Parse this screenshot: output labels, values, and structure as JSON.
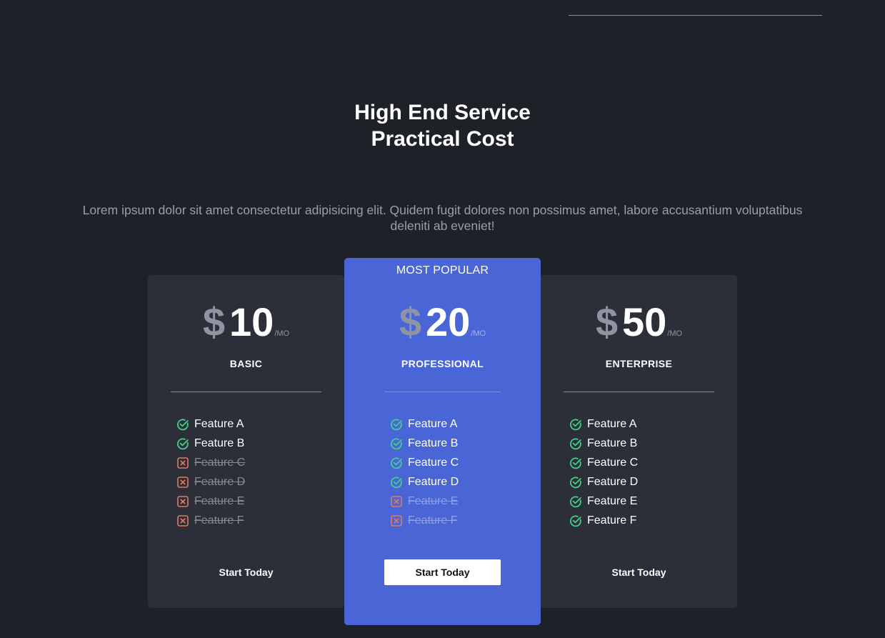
{
  "hero": {
    "title_line1": "High End Service",
    "title_line2": "Practical Cost",
    "description": "Lorem ipsum dolor sit amet consectetur adipisicing elit. Quidem fugit dolores non possimus amet, labore accusantium voluptatibus deleniti ab eveniet!"
  },
  "colors": {
    "background": "#1f2129",
    "card": "#2c2f38",
    "accent": "#4a65d6",
    "check": "#3fd18a",
    "cross": "#e07a62"
  },
  "plans": [
    {
      "currency": "$",
      "amount": "10",
      "period": "/MO",
      "name": "BASIC",
      "cta": "Start Today",
      "features": [
        {
          "label": "Feature A",
          "included": true,
          "icon": "check-circle-icon"
        },
        {
          "label": "Feature B",
          "included": true,
          "icon": "check-circle-icon"
        },
        {
          "label": "Feature C",
          "included": false,
          "icon": "x-square-icon"
        },
        {
          "label": "Feature D",
          "included": false,
          "icon": "x-square-icon"
        },
        {
          "label": "Feature E",
          "included": false,
          "icon": "x-square-icon"
        },
        {
          "label": "Feature F",
          "included": false,
          "icon": "x-square-icon"
        }
      ]
    },
    {
      "badge": "MOST POPULAR",
      "currency": "$",
      "amount": "20",
      "period": "/MO",
      "name": "PROFESSIONAL",
      "cta": "Start Today",
      "features": [
        {
          "label": "Feature A",
          "included": true,
          "icon": "check-circle-icon"
        },
        {
          "label": "Feature B",
          "included": true,
          "icon": "check-circle-icon"
        },
        {
          "label": "Feature C",
          "included": true,
          "icon": "check-circle-icon"
        },
        {
          "label": "Feature D",
          "included": true,
          "icon": "check-circle-icon"
        },
        {
          "label": "Feature E",
          "included": false,
          "icon": "x-square-icon"
        },
        {
          "label": "Feature F",
          "included": false,
          "icon": "x-square-icon"
        }
      ]
    },
    {
      "currency": "$",
      "amount": "50",
      "period": "/MO",
      "name": "ENTERPRISE",
      "cta": "Start Today",
      "features": [
        {
          "label": "Feature A",
          "included": true,
          "icon": "check-circle-icon"
        },
        {
          "label": "Feature B",
          "included": true,
          "icon": "check-circle-icon"
        },
        {
          "label": "Feature C",
          "included": true,
          "icon": "check-circle-icon"
        },
        {
          "label": "Feature D",
          "included": true,
          "icon": "check-circle-icon"
        },
        {
          "label": "Feature E",
          "included": true,
          "icon": "check-circle-icon"
        },
        {
          "label": "Feature F",
          "included": true,
          "icon": "check-circle-icon"
        }
      ]
    }
  ]
}
